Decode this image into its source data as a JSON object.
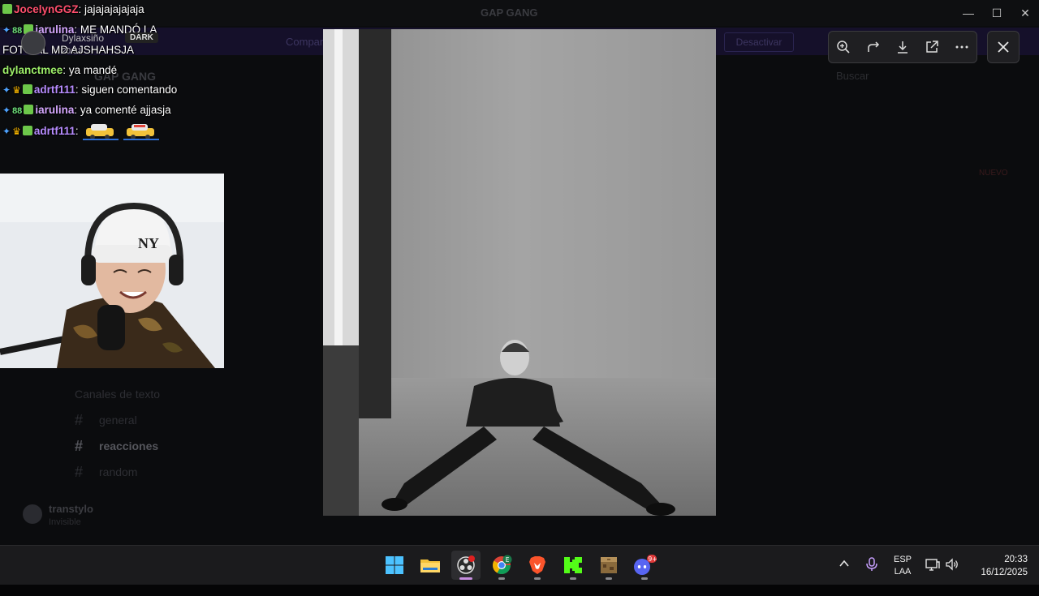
{
  "window": {
    "title": "GAP GANG",
    "banner_text": "Comparte",
    "banner_button": "Desactivar",
    "server_name": "GAP GANG",
    "search_placeholder": "Buscar",
    "badge_text": "NUEVO",
    "channel_category": "Canales de texto",
    "channels": [
      "general",
      "reacciones",
      "random"
    ],
    "user": {
      "name": "transtylo",
      "status": "Invisible"
    }
  },
  "chat_overlay": {
    "messages": [
      {
        "user": "JocelynGGZ",
        "color": "#ff4f6d",
        "badges": [
          "green"
        ],
        "text": "jajajajajajaja"
      },
      {
        "user": "iarulina",
        "color": "#d6a8ff",
        "badges": [
          "sword",
          "88",
          "green"
        ],
        "text": "ME MANDÓ LA FOTO AL MD AJSHAHSJA"
      },
      {
        "user": "dylanctmee",
        "color": "#9ef06a",
        "badges": [],
        "text": "ya mandé"
      },
      {
        "user": "adrtf111",
        "color": "#b78cff",
        "badges": [
          "sword",
          "crown",
          "green"
        ],
        "text": "siguen comentando"
      },
      {
        "user": "iarulina",
        "color": "#d6a8ff",
        "badges": [
          "sword",
          "88",
          "green"
        ],
        "text": "ya comenté ajjasja"
      },
      {
        "user": "adrtf111",
        "color": "#b78cff",
        "badges": [
          "sword",
          "crown",
          "green"
        ],
        "text": ""
      }
    ],
    "notification": {
      "name": "Dylaxsiño",
      "tag": "DARK",
      "time": "20:31"
    }
  },
  "viewer": {
    "toolbar": [
      {
        "icon": "zoom-in-icon",
        "label": "Zoom in"
      },
      {
        "icon": "rotate-icon",
        "label": "Rotate"
      },
      {
        "icon": "download-icon",
        "label": "Download"
      },
      {
        "icon": "open-external-icon",
        "label": "Open in browser"
      },
      {
        "icon": "more-icon",
        "label": "More"
      }
    ],
    "close_icon": "close-icon"
  },
  "taskbar": {
    "apps": [
      "start-icon",
      "file-explorer-icon",
      "obs-icon",
      "chrome-icon",
      "brave-icon",
      "kick-icon",
      "minecraft-icon",
      "discord-icon"
    ],
    "discord_badge": "9+",
    "chrome_badge": "E",
    "language": {
      "top": "ESP",
      "bottom": "LAA"
    },
    "time": "20:33",
    "date": "16/12/2025"
  }
}
